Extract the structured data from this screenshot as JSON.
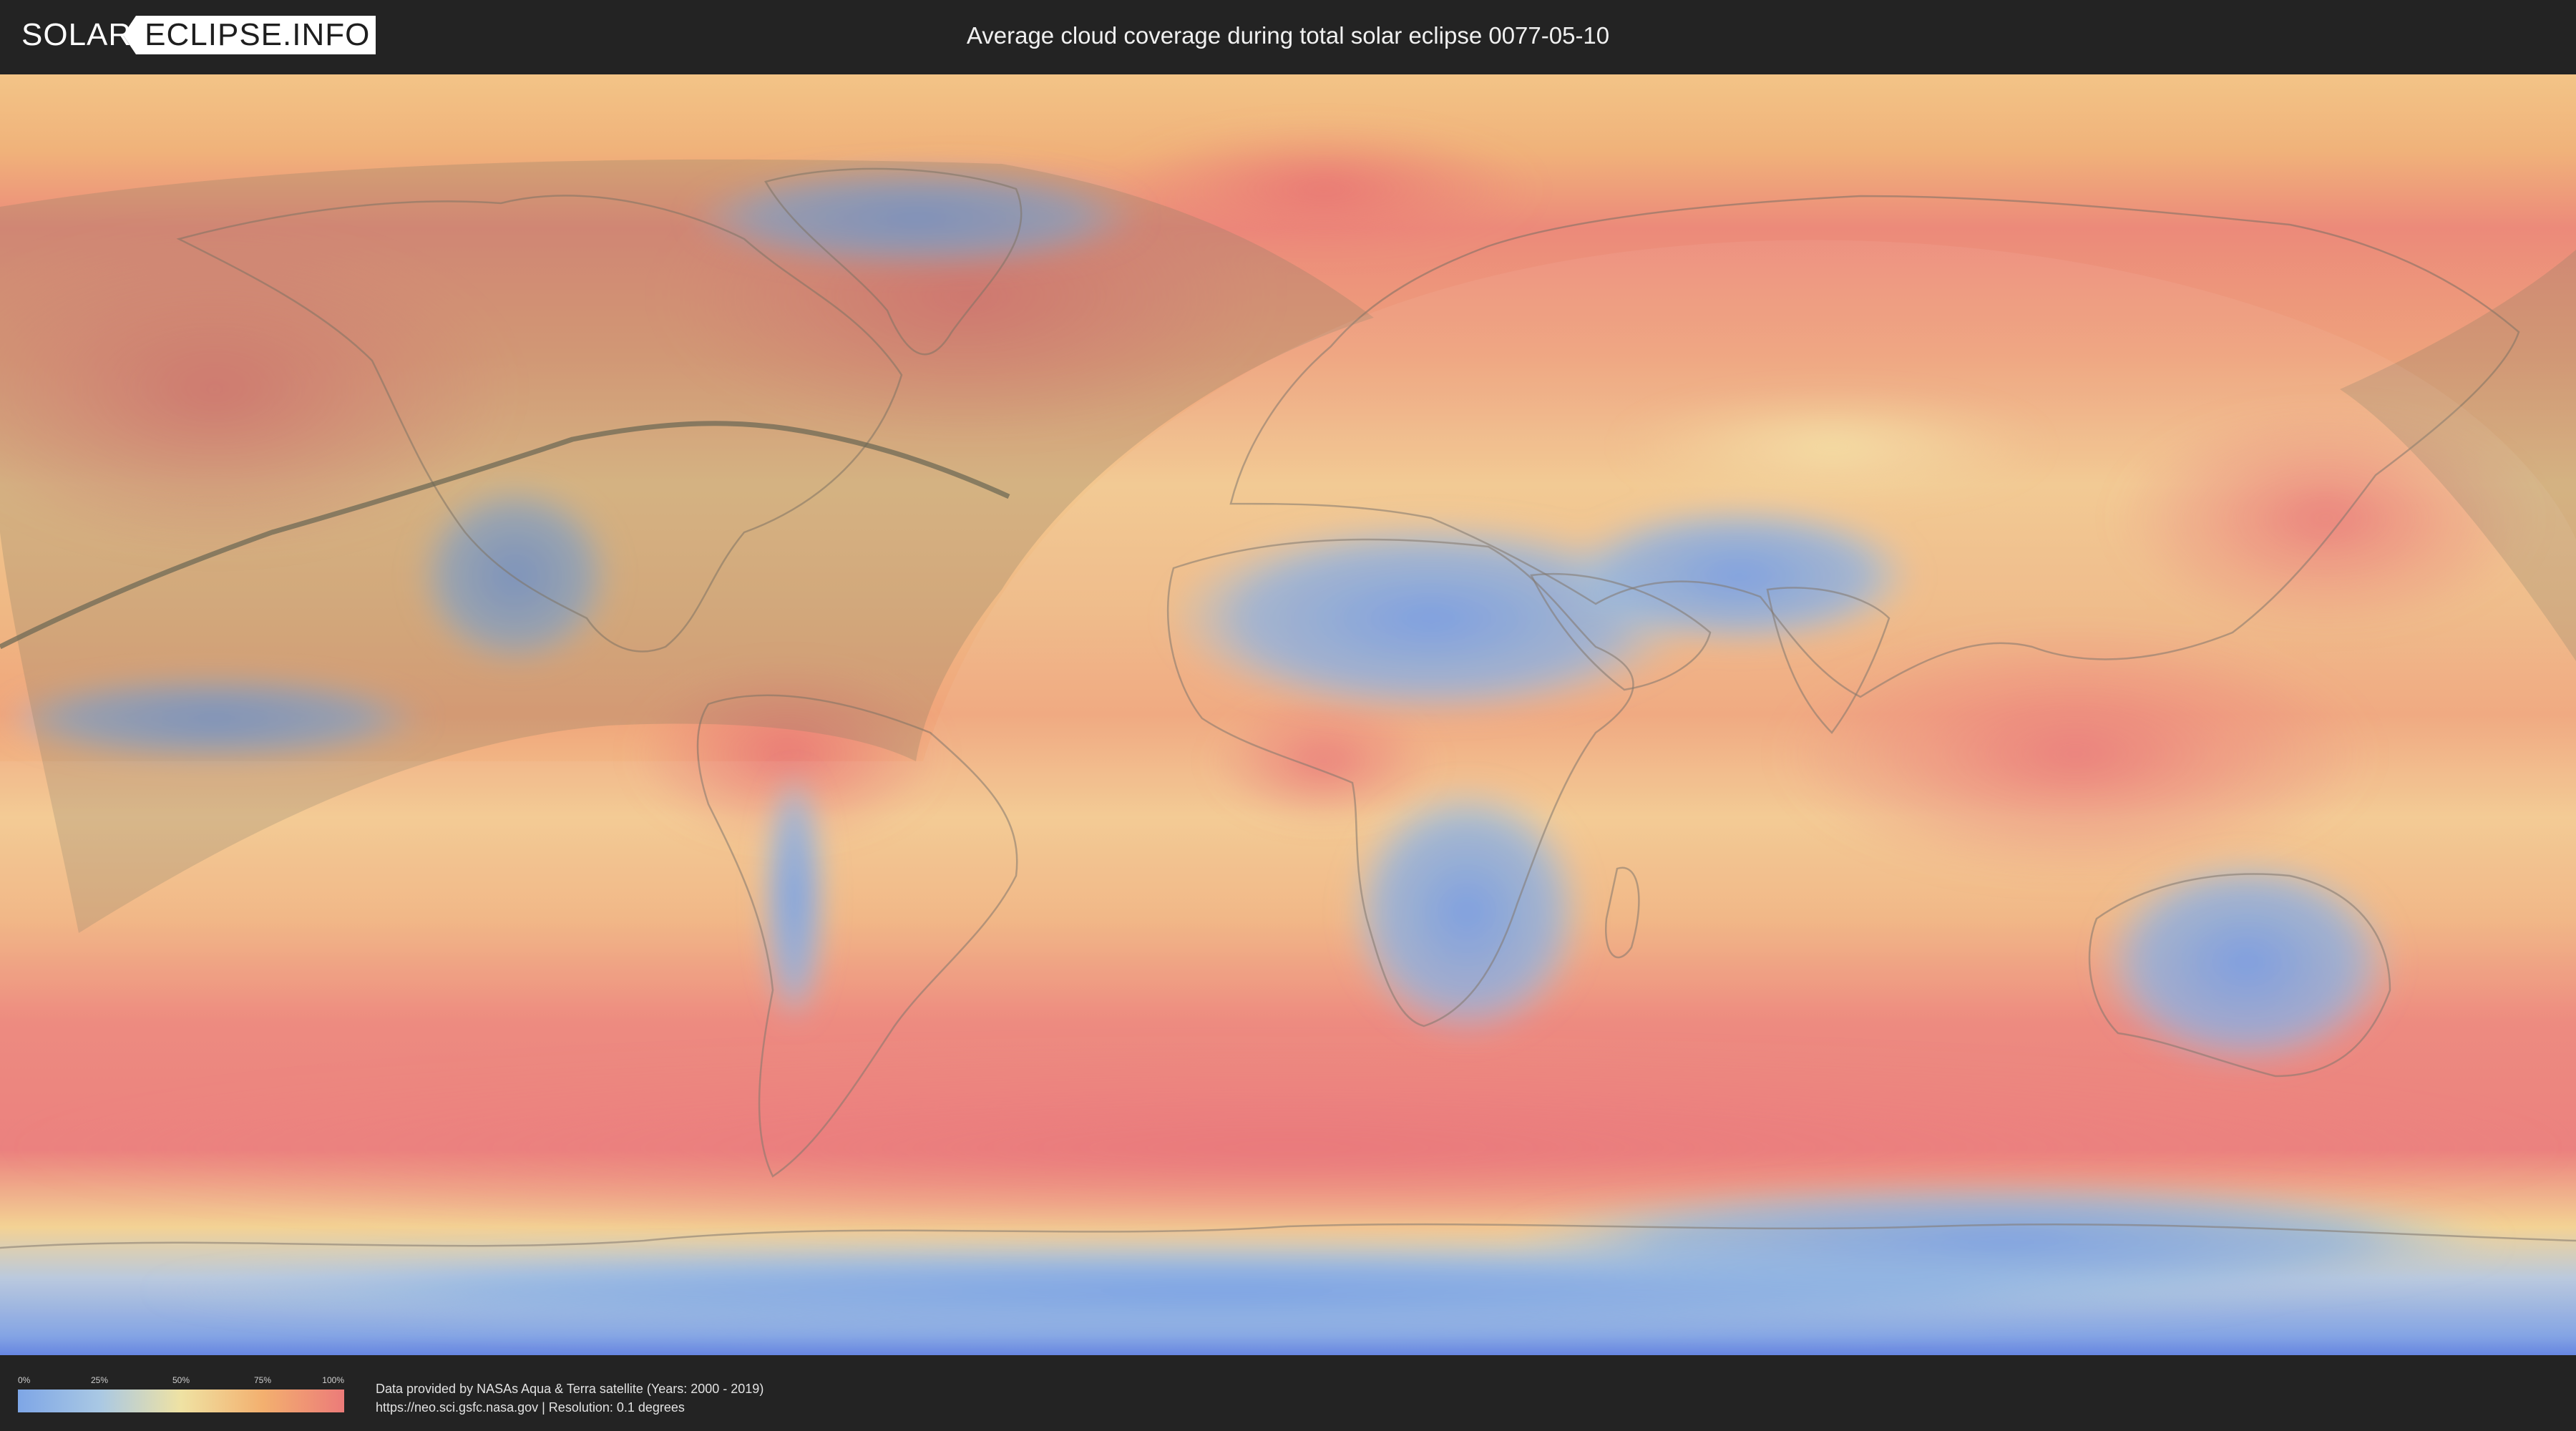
{
  "header": {
    "logo_solar": "SOLAR",
    "logo_eclipse": "ECLIPSE.INFO",
    "title": "Average cloud coverage during total solar eclipse 0077-05-10"
  },
  "legend": {
    "ticks": [
      "0%",
      "25%",
      "50%",
      "75%",
      "100%"
    ],
    "colors": [
      "#7ea6e6",
      "#a9c8e4",
      "#efe2a3",
      "#f3b06f",
      "#ec7b79"
    ]
  },
  "footer": {
    "source_line1": "Data provided by NASAs Aqua & Terra satellite (Years: 2000 - 2019)",
    "source_line2": "https://neo.sci.gsfc.nasa.gov | Resolution: 0.1 degrees"
  },
  "map": {
    "icons": [
      "logo-arrow-icon"
    ],
    "colors": {
      "clear": "#7ea6e6",
      "partly": "#f0e3a8",
      "cloudy": "#ec7b79",
      "umbra_shade": "#8a8060",
      "eclipse_path": "#6f6a55"
    }
  }
}
